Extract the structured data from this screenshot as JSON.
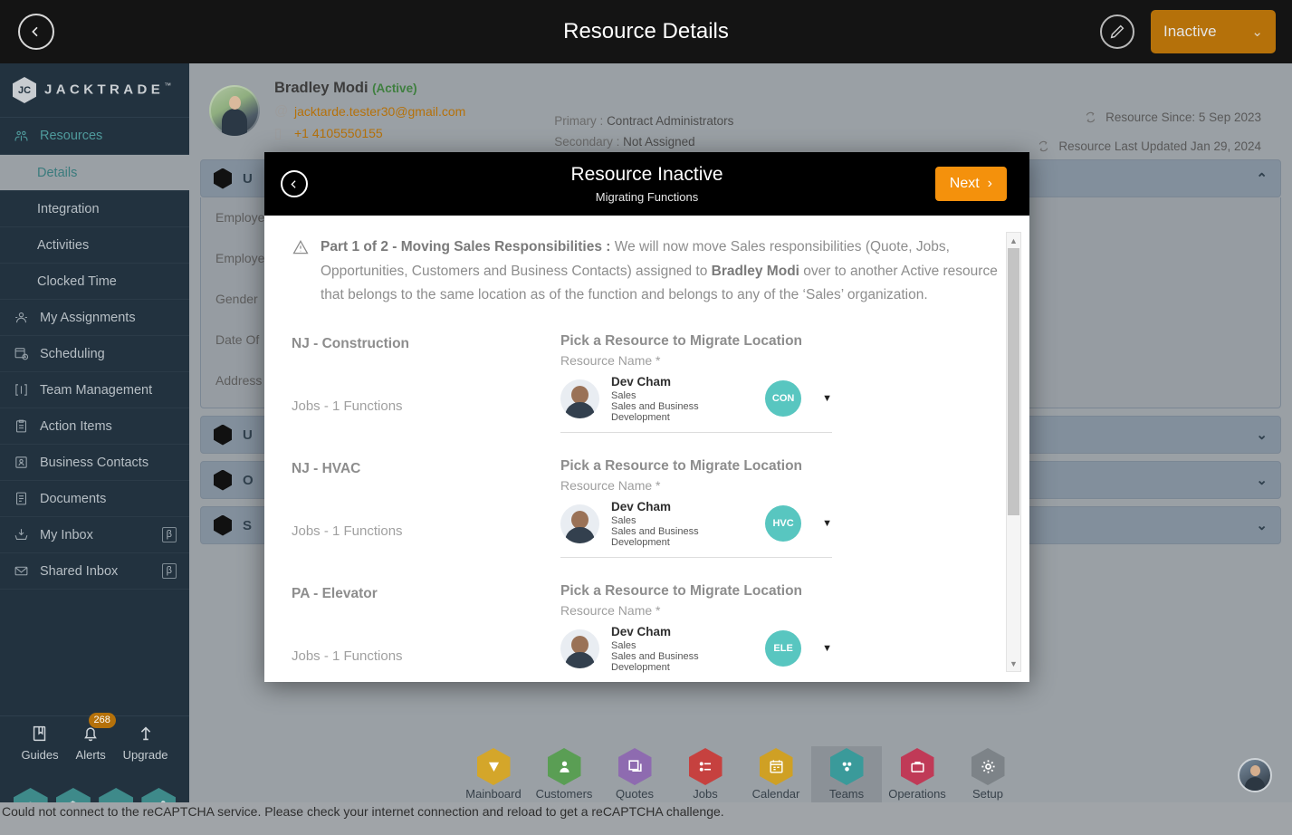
{
  "topbar": {
    "back_icon": "chevron-left-circle-icon",
    "title": "Resource Details",
    "edit_icon": "pencil-circle-icon",
    "status_value": "Inactive",
    "status_chevron": "⌄"
  },
  "sidebar": {
    "brand": "JACKTRADE",
    "brand_mark": "JC",
    "brand_tm": "™",
    "items": [
      {
        "label": "Resources",
        "icon": "resources-icon",
        "type": "section"
      },
      {
        "label": "Details",
        "icon": "",
        "type": "sub",
        "active": true
      },
      {
        "label": "Integration",
        "icon": "",
        "type": "sub",
        "active": false
      },
      {
        "label": "Activities",
        "icon": "",
        "type": "sub",
        "active": false
      },
      {
        "label": "Clocked Time",
        "icon": "",
        "type": "sub",
        "active": false
      },
      {
        "label": "My Assignments",
        "icon": "assignments-icon",
        "type": "item"
      },
      {
        "label": "Scheduling",
        "icon": "calendar-clock-icon",
        "type": "item"
      },
      {
        "label": "Team Management",
        "icon": "team-brackets-icon",
        "type": "item"
      },
      {
        "label": "Action Items",
        "icon": "clipboard-icon",
        "type": "item"
      },
      {
        "label": "Business Contacts",
        "icon": "contact-card-icon",
        "type": "item"
      },
      {
        "label": "Documents",
        "icon": "document-icon",
        "type": "item"
      },
      {
        "label": "My Inbox",
        "icon": "inbox-download-icon",
        "type": "item",
        "badge": "β"
      },
      {
        "label": "Shared Inbox",
        "icon": "envelope-icon",
        "type": "item",
        "badge": "β"
      }
    ],
    "quick": [
      {
        "label": "Guides",
        "icon": "book-icon"
      },
      {
        "label": "Alerts",
        "icon": "bell-icon",
        "badge": "268"
      },
      {
        "label": "Upgrade",
        "icon": "upload-arrow-icon"
      }
    ],
    "hex_buttons": [
      {
        "icon": "person-icon"
      },
      {
        "icon": "dollar-icon"
      },
      {
        "icon": "money-transfer-icon"
      },
      {
        "icon": "workflow-icon"
      }
    ]
  },
  "profile": {
    "avatar": "user-photo",
    "name": "Bradley Modi",
    "state": "(Active)",
    "email_icon": "at-icon",
    "email": "jacktarde.tester30@gmail.com",
    "phone_icon": "phone-icon",
    "phone": "+1 4105550155",
    "primary_label": "Primary :",
    "primary_value": "Contract Administrators",
    "secondary_label": "Secondary :",
    "secondary_value": "Not Assigned",
    "since_icon": "refresh-icon",
    "since": "Resource Since: 5 Sep 2023",
    "updated_icon": "refresh-icon",
    "updated": "Resource Last Updated Jan 29, 2024"
  },
  "accordions": [
    {
      "title": "U",
      "expanded": true,
      "chevron": "⌃",
      "fields": [
        "Employe",
        "Employe",
        "Gender",
        "Date Of",
        "Address"
      ]
    },
    {
      "title": "U",
      "expanded": false,
      "chevron": "⌄",
      "fields": []
    },
    {
      "title": "O",
      "expanded": false,
      "chevron": "⌄",
      "fields": []
    },
    {
      "title": "S",
      "expanded": false,
      "chevron": "⌄",
      "fields": []
    }
  ],
  "modal": {
    "back_icon": "chevron-left-circle-icon",
    "title": "Resource Inactive",
    "subtitle": "Migrating Functions",
    "next_label": "Next",
    "next_chevron": "›",
    "warning_icon": "warning-triangle-icon",
    "notice": {
      "lead": "Part 1 of 2 - Moving Sales Responsibilities :",
      "body": " We will now move Sales responsibilities (Quote, Jobs, Opportunities, Customers and Business Contacts) assigned to ",
      "bold_name": "Bradley Modi",
      "tail": " over to another Active resource that belongs to the same location as of the function and belongs to any of the ‘Sales’ organization."
    },
    "pick_title": "Pick a Resource to Migrate Location",
    "pick_label": "Resource Name *",
    "rows": [
      {
        "location": "NJ - Construction",
        "jobs": "Jobs - 1 Functions",
        "resource_name": "Dev Cham",
        "resource_role": "Sales",
        "resource_org": "Sales and Business Development",
        "chip": "CON",
        "caret": "▼"
      },
      {
        "location": "NJ - HVAC",
        "jobs": "Jobs - 1 Functions",
        "resource_name": "Dev Cham",
        "resource_role": "Sales",
        "resource_org": "Sales and Business Development",
        "chip": "HVC",
        "caret": "▼"
      },
      {
        "location": "PA - Elevator",
        "jobs": "Jobs - 1 Functions",
        "resource_name": "Dev Cham",
        "resource_role": "Sales",
        "resource_org": "Sales and Business Development",
        "chip": "ELE",
        "caret": "▼"
      }
    ],
    "scroll_up": "▲",
    "scroll_down": "▼"
  },
  "bottomnav": [
    {
      "label": "Mainboard",
      "icon": "mainboard-icon",
      "color": "#d4a62a",
      "active": false
    },
    {
      "label": "Customers",
      "icon": "customers-icon",
      "color": "#5a9e54",
      "active": false
    },
    {
      "label": "Quotes",
      "icon": "quotes-icon",
      "color": "#8e6bb0",
      "active": false
    },
    {
      "label": "Jobs",
      "icon": "jobs-icon",
      "color": "#c6413f",
      "active": false
    },
    {
      "label": "Calendar",
      "icon": "calendar-icon",
      "color": "#cfa024",
      "active": false
    },
    {
      "label": "Teams",
      "icon": "teams-icon",
      "color": "#3a9a9a",
      "active": true
    },
    {
      "label": "Operations",
      "icon": "operations-icon",
      "color": "#c03a57",
      "active": false
    },
    {
      "label": "Setup",
      "icon": "setup-gear-icon",
      "color": "#7d8388",
      "active": false
    }
  ],
  "statusbar": {
    "message": "Could not connect to the reCAPTCHA service. Please check your internet connection and reload to get a reCAPTCHA challenge."
  },
  "colors": {
    "accent_orange": "#f4910c",
    "status_amber": "#b5710a",
    "sidebar_dark": "#22323f",
    "teal": "#3e8a8a",
    "chip_teal": "#58c6c0"
  }
}
